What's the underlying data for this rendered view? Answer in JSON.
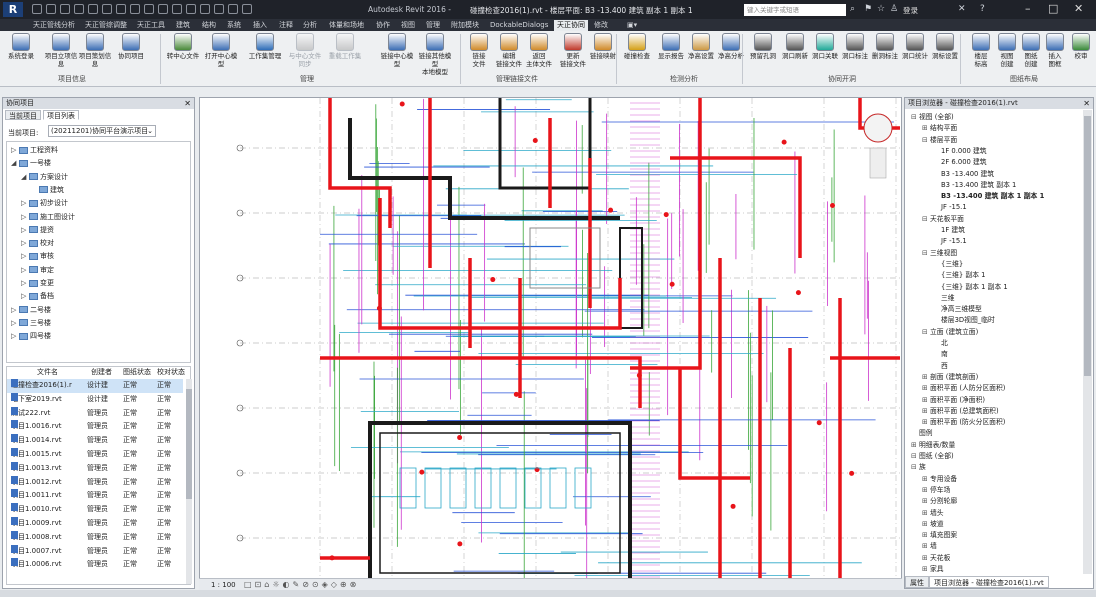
{
  "titlebar": {
    "app_title": "Autodesk Revit 2016 -",
    "doc_title": "碰撞检查2016(1).rvt - 楼层平面: B3 -13.400 建筑 副本 1 副本 1",
    "search_placeholder": "键入关键字或短语",
    "login": "登录"
  },
  "tabs": [
    "天正管线分析",
    "天正管综调整",
    "天正工具",
    "建筑",
    "结构",
    "系统",
    "插入",
    "注释",
    "分析",
    "体量和场地",
    "协作",
    "视图",
    "管理",
    "附加模块",
    "DockableDialogs",
    "天正协同",
    "修改"
  ],
  "active_tab": "天正协同",
  "ribbon": {
    "buttons": [
      {
        "label": "系统登录",
        "disabled": false
      },
      {
        "label": "项目立项信息",
        "disabled": false
      },
      {
        "label": "项目策划信息",
        "disabled": false
      },
      {
        "label": "协同项目",
        "disabled": false
      },
      {
        "label": "转中心文件",
        "disabled": false
      },
      {
        "label": "打开中心模型",
        "disabled": false
      },
      {
        "label": "工作集管理",
        "disabled": false
      },
      {
        "label": "与中心文件同步",
        "disabled": true
      },
      {
        "label": "重载工作集",
        "disabled": true
      },
      {
        "label": "链接中心模型",
        "disabled": false
      },
      {
        "label": "链接其他模型\n本地模型",
        "disabled": false
      },
      {
        "label": "链接\n文件",
        "disabled": false
      },
      {
        "label": "编辑\n链接文件",
        "disabled": false
      },
      {
        "label": "返回\n主体文件",
        "disabled": false
      },
      {
        "label": "更新\n链接文件",
        "disabled": false
      },
      {
        "label": "链接映射",
        "disabled": false
      },
      {
        "label": "碰撞检查",
        "disabled": false
      },
      {
        "label": "显示报告",
        "disabled": false
      },
      {
        "label": "净高设置",
        "disabled": false
      },
      {
        "label": "净高分析",
        "disabled": false
      },
      {
        "label": "预留孔洞",
        "disabled": false
      },
      {
        "label": "洞口刷新",
        "disabled": false
      },
      {
        "label": "洞口关联",
        "disabled": false
      },
      {
        "label": "洞口标注",
        "disabled": false
      },
      {
        "label": "删洞标注",
        "disabled": false
      },
      {
        "label": "洞口统计",
        "disabled": false
      },
      {
        "label": "洞标设置",
        "disabled": false
      },
      {
        "label": "楼层\n标高",
        "disabled": false
      },
      {
        "label": "视图\n创建",
        "disabled": false
      },
      {
        "label": "图纸\n创建",
        "disabled": false
      },
      {
        "label": "插入\n图框",
        "disabled": false
      },
      {
        "label": "校审",
        "disabled": false
      }
    ],
    "groups": [
      "项目信息",
      "管理",
      "管理链接文件",
      "检测分析",
      "协同开洞",
      "图纸布局"
    ]
  },
  "left_panel": {
    "title": "协同项目",
    "tabs": [
      "当前项目",
      "项目列表"
    ],
    "current_project_label": "当前项目:",
    "current_project": "(20211201)协同平台演示项目",
    "tree": [
      {
        "label": "工程资料",
        "level": 0,
        "exp": "▷"
      },
      {
        "label": "一号楼",
        "level": 0,
        "exp": "◢"
      },
      {
        "label": "方案设计",
        "level": 1,
        "exp": "◢"
      },
      {
        "label": "建筑",
        "level": 2,
        "exp": ""
      },
      {
        "label": "初步设计",
        "level": 1,
        "exp": "▷"
      },
      {
        "label": "施工图设计",
        "level": 1,
        "exp": "▷"
      },
      {
        "label": "提资",
        "level": 1,
        "exp": "▷"
      },
      {
        "label": "校对",
        "level": 1,
        "exp": "▷"
      },
      {
        "label": "审核",
        "level": 1,
        "exp": "▷"
      },
      {
        "label": "审定",
        "level": 1,
        "exp": "▷"
      },
      {
        "label": "变更",
        "level": 1,
        "exp": "▷"
      },
      {
        "label": "备档",
        "level": 1,
        "exp": "▷"
      },
      {
        "label": "二号楼",
        "level": 0,
        "exp": "▷"
      },
      {
        "label": "三号楼",
        "level": 0,
        "exp": "▷"
      },
      {
        "label": "四号楼",
        "level": 0,
        "exp": "▷"
      }
    ],
    "file_columns": [
      "文件名",
      "创建者",
      "图纸状态",
      "校对状态"
    ],
    "files": [
      [
        "碰撞检查2016(1).r",
        "设计建",
        "正常",
        "正常"
      ],
      [
        "地下室2019.rvt",
        "设计建",
        "正常",
        "正常"
      ],
      [
        "测试222.rvt",
        "管理员",
        "正常",
        "正常"
      ],
      [
        "项目1.0016.rvt",
        "管理员",
        "正常",
        "正常"
      ],
      [
        "项目1.0014.rvt",
        "管理员",
        "正常",
        "正常"
      ],
      [
        "项目1.0015.rvt",
        "管理员",
        "正常",
        "正常"
      ],
      [
        "项目1.0013.rvt",
        "管理员",
        "正常",
        "正常"
      ],
      [
        "项目1.0012.rvt",
        "管理员",
        "正常",
        "正常"
      ],
      [
        "项目1.0011.rvt",
        "管理员",
        "正常",
        "正常"
      ],
      [
        "项目1.0010.rvt",
        "管理员",
        "正常",
        "正常"
      ],
      [
        "项目1.0009.rvt",
        "管理员",
        "正常",
        "正常"
      ],
      [
        "项目1.0008.rvt",
        "管理员",
        "正常",
        "正常"
      ],
      [
        "项目1.0007.rvt",
        "管理员",
        "正常",
        "正常"
      ],
      [
        "项目1.0006.rvt",
        "管理员",
        "正常",
        "正常"
      ]
    ]
  },
  "view_control": {
    "scale": "1 : 100"
  },
  "right_panel": {
    "title": "项目浏览器 - 碰撞检查2016(1).rvt",
    "tree": [
      {
        "label": "视图 (全部)",
        "level": 0,
        "exp": "⊟",
        "bold": false
      },
      {
        "label": "结构平面",
        "level": 1,
        "exp": "⊞",
        "bold": false
      },
      {
        "label": "楼层平面",
        "level": 1,
        "exp": "⊟",
        "bold": false
      },
      {
        "label": "1F 0.000 建筑",
        "level": 2,
        "exp": "",
        "bold": false
      },
      {
        "label": "2F 6.000 建筑",
        "level": 2,
        "exp": "",
        "bold": false
      },
      {
        "label": "B3 -13.400 建筑",
        "level": 2,
        "exp": "",
        "bold": false
      },
      {
        "label": "B3 -13.400 建筑 副本 1",
        "level": 2,
        "exp": "",
        "bold": false
      },
      {
        "label": "B3 -13.400 建筑 副本 1 副本 1",
        "level": 2,
        "exp": "",
        "bold": true
      },
      {
        "label": "JF -15.1",
        "level": 2,
        "exp": "",
        "bold": false
      },
      {
        "label": "天花板平面",
        "level": 1,
        "exp": "⊟",
        "bold": false
      },
      {
        "label": "1F 建筑",
        "level": 2,
        "exp": "",
        "bold": false
      },
      {
        "label": "JF -15.1",
        "level": 2,
        "exp": "",
        "bold": false
      },
      {
        "label": "三维视图",
        "level": 1,
        "exp": "⊟",
        "bold": false
      },
      {
        "label": "{三维}",
        "level": 2,
        "exp": "",
        "bold": false
      },
      {
        "label": "{三维} 副本 1",
        "level": 2,
        "exp": "",
        "bold": false
      },
      {
        "label": "{三维} 副本 1 副本 1",
        "level": 2,
        "exp": "",
        "bold": false
      },
      {
        "label": "三维",
        "level": 2,
        "exp": "",
        "bold": false
      },
      {
        "label": "净高三维模型",
        "level": 2,
        "exp": "",
        "bold": false
      },
      {
        "label": "楼层3D视图_临时",
        "level": 2,
        "exp": "",
        "bold": false
      },
      {
        "label": "立面 (建筑立面)",
        "level": 1,
        "exp": "⊟",
        "bold": false
      },
      {
        "label": "北",
        "level": 2,
        "exp": "",
        "bold": false
      },
      {
        "label": "南",
        "level": 2,
        "exp": "",
        "bold": false
      },
      {
        "label": "西",
        "level": 2,
        "exp": "",
        "bold": false
      },
      {
        "label": "剖面 (建筑剖面)",
        "level": 1,
        "exp": "⊞",
        "bold": false
      },
      {
        "label": "面积平面 (人防分区面积)",
        "level": 1,
        "exp": "⊞",
        "bold": false
      },
      {
        "label": "面积平面 (净面积)",
        "level": 1,
        "exp": "⊞",
        "bold": false
      },
      {
        "label": "面积平面 (总建筑面积)",
        "level": 1,
        "exp": "⊞",
        "bold": false
      },
      {
        "label": "面积平面 (防火分区面积)",
        "level": 1,
        "exp": "⊞",
        "bold": false
      },
      {
        "label": "图例",
        "level": 0,
        "exp": "",
        "bold": false
      },
      {
        "label": "明细表/数量",
        "level": 0,
        "exp": "⊞",
        "bold": false
      },
      {
        "label": "图纸 (全部)",
        "level": 0,
        "exp": "⊟",
        "bold": false
      },
      {
        "label": "族",
        "level": 0,
        "exp": "⊟",
        "bold": false
      },
      {
        "label": "专用设备",
        "level": 1,
        "exp": "⊞",
        "bold": false
      },
      {
        "label": "停车场",
        "level": 1,
        "exp": "⊞",
        "bold": false
      },
      {
        "label": "分割轮廓",
        "level": 1,
        "exp": "⊞",
        "bold": false
      },
      {
        "label": "墙头",
        "level": 1,
        "exp": "⊞",
        "bold": false
      },
      {
        "label": "坡道",
        "level": 1,
        "exp": "⊞",
        "bold": false
      },
      {
        "label": "填充图案",
        "level": 1,
        "exp": "⊞",
        "bold": false
      },
      {
        "label": "墙",
        "level": 1,
        "exp": "⊞",
        "bold": false
      },
      {
        "label": "天花板",
        "level": 1,
        "exp": "⊞",
        "bold": false
      },
      {
        "label": "家具",
        "level": 1,
        "exp": "⊞",
        "bold": false
      }
    ],
    "bottom_tabs": [
      "属性",
      "项目浏览器 - 碰撞检查2016(1).rvt"
    ]
  },
  "colors": {
    "clash_red": "#e8141a",
    "duct": "#1a1a1a",
    "pipe_magenta": "#cc33cc",
    "pipe_cyan": "#2ba8c8",
    "pipe_green": "#3aa63a",
    "pipe_blue": "#2a55d8"
  }
}
